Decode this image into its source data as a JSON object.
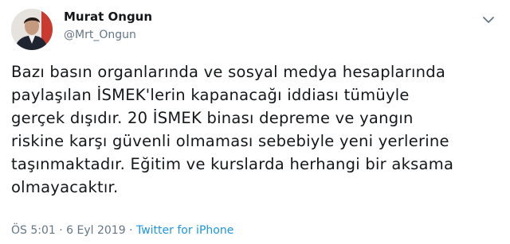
{
  "author": {
    "name": "Murat Ongun",
    "handle": "@Mrt_Ongun"
  },
  "tweet": {
    "lines": [
      "Bazı basın organlarında ve sosyal medya hesaplarında",
      "paylaşılan İSMEK'lerin kapanacağı iddiası tümüyle",
      "gerçek dışıdır. 20 İSMEK binası depreme ve yangın",
      "riskine karşı güvenli olmaması sebebiyle yeni yerlerine",
      "taşınmaktadır. Eğitim ve kurslarda herhangi bir aksama",
      "olmayacaktır."
    ]
  },
  "meta": {
    "time": "ÖS 5:01",
    "separator": " · ",
    "date": "6 Eyl 2019",
    "separator2": " · ",
    "source": "Twitter for iPhone"
  },
  "icons": {
    "menu": "chevron-down-icon",
    "avatar": "profile-photo"
  },
  "colors": {
    "text": "#14171a",
    "secondary": "#657786",
    "link": "#1b95e0"
  }
}
